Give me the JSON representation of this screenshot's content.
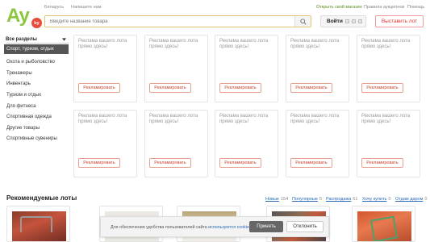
{
  "header": {
    "links_left": [
      "Беларусь",
      "Напишите нам"
    ],
    "links_right": [
      "Открыть свой магазин",
      "Правила аукционов",
      "Помощь"
    ],
    "logo_text": "Ay",
    "logo_badge": "by",
    "search_placeholder": "Введите название товара",
    "login_label": "Войти",
    "post_lot_label": "Выставить лот"
  },
  "sidebar": {
    "header": "Все разделы",
    "selected": "Спорт, туризм, отдых",
    "items": [
      "Охота и рыболовство",
      "Тренажеры",
      "Инвентарь",
      "Туризм и отдых",
      "Для фитнеса",
      "Спортивная одежда",
      "Другие товары",
      "Спортивные сувениры"
    ]
  },
  "ads": {
    "text": "Рекламa вашего лота прямо здесь!",
    "button": "Рекламировать"
  },
  "recommended": {
    "title": "Рекомендуемые лоты",
    "filters": [
      {
        "label": "Новые",
        "count": "154"
      },
      {
        "label": "Популярные",
        "count": "5"
      },
      {
        "label": "Распродажа",
        "count": "61"
      },
      {
        "label": "Хочу купить",
        "count": "0"
      },
      {
        "label": "Отдам даром",
        "count": "0"
      }
    ]
  },
  "cookie": {
    "text_before": "Для обеспечения удобства пользователей сайта ",
    "link": "используются cookies",
    "text_after": ".",
    "accept": "Принять",
    "decline": "Отклонить"
  },
  "colors": {
    "logo_green": "#8dc63f",
    "logo_red": "#e84c3d",
    "ad_button": "#c7452f",
    "link_blue": "#2a6ab5"
  },
  "icons": [
    "search-icon",
    "chevron-down-icon",
    "social-login-icon"
  ]
}
